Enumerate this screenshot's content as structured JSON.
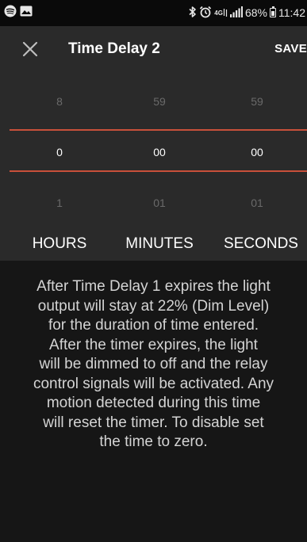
{
  "status_bar": {
    "left_icons": [
      "spotify-icon",
      "image-icon"
    ],
    "right_icons": [
      "bluetooth-icon",
      "alarm-icon",
      "network-icon",
      "signal-icon"
    ],
    "network_label": "4G",
    "battery_percent": "68%",
    "time": "11:42"
  },
  "app_bar": {
    "close_icon": "close-icon",
    "title": "Time Delay 2",
    "save_label": "SAVE"
  },
  "picker": {
    "hours": {
      "above": "8",
      "selected": "0",
      "below": "1",
      "label": "HOURS"
    },
    "minutes": {
      "above": "59",
      "selected": "00",
      "below": "01",
      "label": "MINUTES"
    },
    "seconds": {
      "above": "59",
      "selected": "00",
      "below": "01",
      "label": "SECONDS"
    },
    "accent_color": "#c8503a"
  },
  "description": {
    "lines": [
      "After Time Delay 1 expires the light",
      "output will stay at 22% (Dim Level)",
      "for the duration of time entered.",
      "After the timer expires, the light",
      "will be dimmed to off and the relay",
      "control signals will be activated. Any",
      "motion detected during this time",
      "will reset the timer. To disable set",
      "the time to zero."
    ]
  }
}
